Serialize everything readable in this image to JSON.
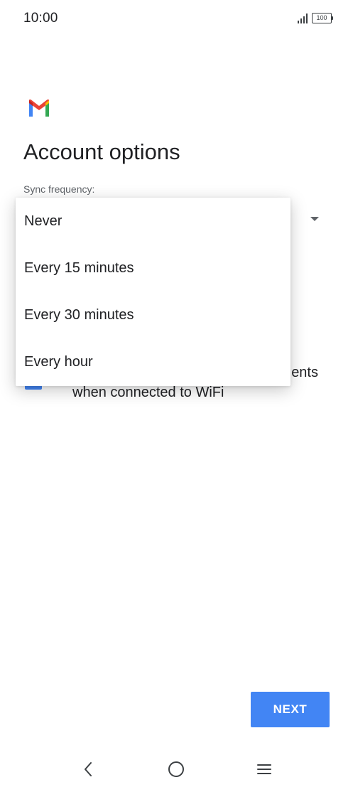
{
  "status_bar": {
    "time": "10:00",
    "battery": "100",
    "signal_icon": "signal-icon",
    "battery_icon": "battery-icon"
  },
  "app": {
    "logo_icon": "gmail-logo-icon",
    "brand_colors": {
      "red": "#ea4335",
      "blue": "#4285f4",
      "green": "#34a853",
      "yellow": "#fbbc04"
    }
  },
  "page": {
    "title": "Account options"
  },
  "sync": {
    "label": "Sync frequency:",
    "options": [
      "Never",
      "Every 15 minutes",
      "Every 30 minutes",
      "Every hour"
    ]
  },
  "download": {
    "line1": "ents",
    "line2": "when connected to WiFi",
    "checked": true
  },
  "actions": {
    "next_label": "NEXT",
    "accent_color": "#4285f4"
  },
  "nav": {
    "back_icon": "back-icon",
    "home_icon": "home-icon",
    "menu_icon": "menu-icon"
  }
}
